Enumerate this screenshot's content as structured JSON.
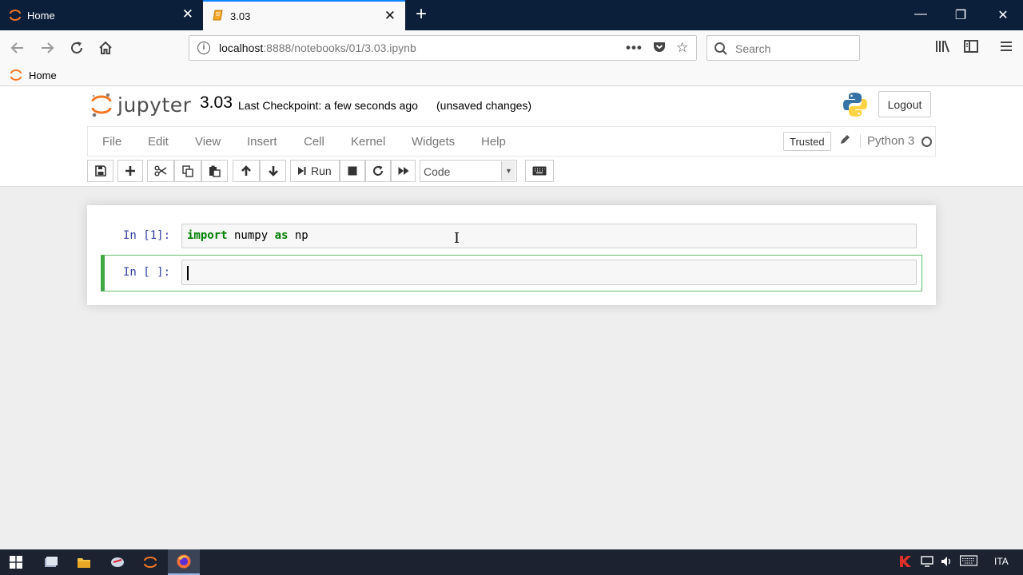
{
  "browser": {
    "tabs": [
      {
        "title": "Home",
        "active": false
      },
      {
        "title": "3.03",
        "active": true
      }
    ],
    "url_host": "localhost",
    "url_path": ":8888/notebooks/01/3.03.ipynb",
    "search_placeholder": "Search",
    "bookmarks": [
      {
        "label": "Home"
      }
    ]
  },
  "jupyter": {
    "logo_text": "jupyter",
    "notebook_name": "3.03",
    "checkpoint": "Last Checkpoint: a few seconds ago",
    "unsaved": "(unsaved changes)",
    "logout_label": "Logout",
    "menu": [
      "File",
      "Edit",
      "View",
      "Insert",
      "Cell",
      "Kernel",
      "Widgets",
      "Help"
    ],
    "trusted_label": "Trusted",
    "kernel_name": "Python 3",
    "toolbar": {
      "run_label": "Run",
      "cell_type": "Code"
    },
    "cells": [
      {
        "prompt": "In [1]:",
        "code_keyword1": "import",
        "code_mid": " numpy ",
        "code_keyword2": "as",
        "code_end": " np"
      },
      {
        "prompt": "In [ ]:",
        "code": ""
      }
    ]
  },
  "taskbar": {
    "language": "ITA"
  },
  "colors": {
    "tabstrip": "#0c1f3a",
    "active_cell_border": "#42a544",
    "prompt_blue": "#303f9f",
    "keyword_green": "#008000",
    "taskbar": "#1c2230"
  }
}
